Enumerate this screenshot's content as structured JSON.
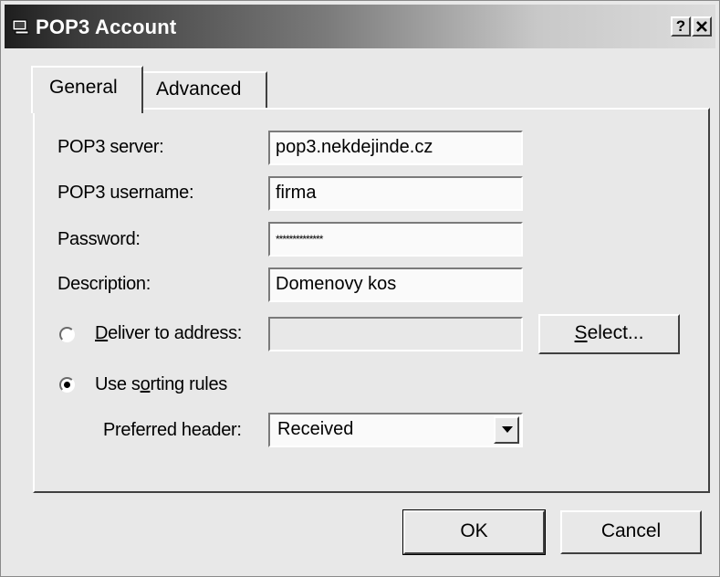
{
  "window": {
    "title": "POP3 Account"
  },
  "titlebar": {
    "help_label": "?",
    "close_label": "✕"
  },
  "tabs": [
    {
      "label": "General",
      "selected": true
    },
    {
      "label": "Advanced",
      "selected": false
    }
  ],
  "form": {
    "pop3_server": {
      "label": "POP3 server:",
      "value": "pop3.nekdejinde.cz"
    },
    "pop3_username": {
      "label": "POP3 username:",
      "value": "firma"
    },
    "password": {
      "label": "Password:",
      "value": "**************"
    },
    "description": {
      "label": "Description:",
      "value": "Domenovy kos"
    },
    "deliver": {
      "label_mnemonic": "D",
      "label_rest": "eliver to address:",
      "selected": false,
      "value": ""
    },
    "sorting": {
      "label_pre": "Use s",
      "label_mnemonic": "o",
      "label_post": "rting rules",
      "selected": true
    },
    "preferred_header": {
      "label": "Preferred header:",
      "value": "Received"
    }
  },
  "buttons": {
    "select": {
      "mnemonic": "S",
      "rest": "elect..."
    },
    "ok": "OK",
    "cancel": "Cancel"
  },
  "icons": {
    "window_icon": "computer-icon",
    "dropdown_arrow": "triangle-down-icon"
  }
}
